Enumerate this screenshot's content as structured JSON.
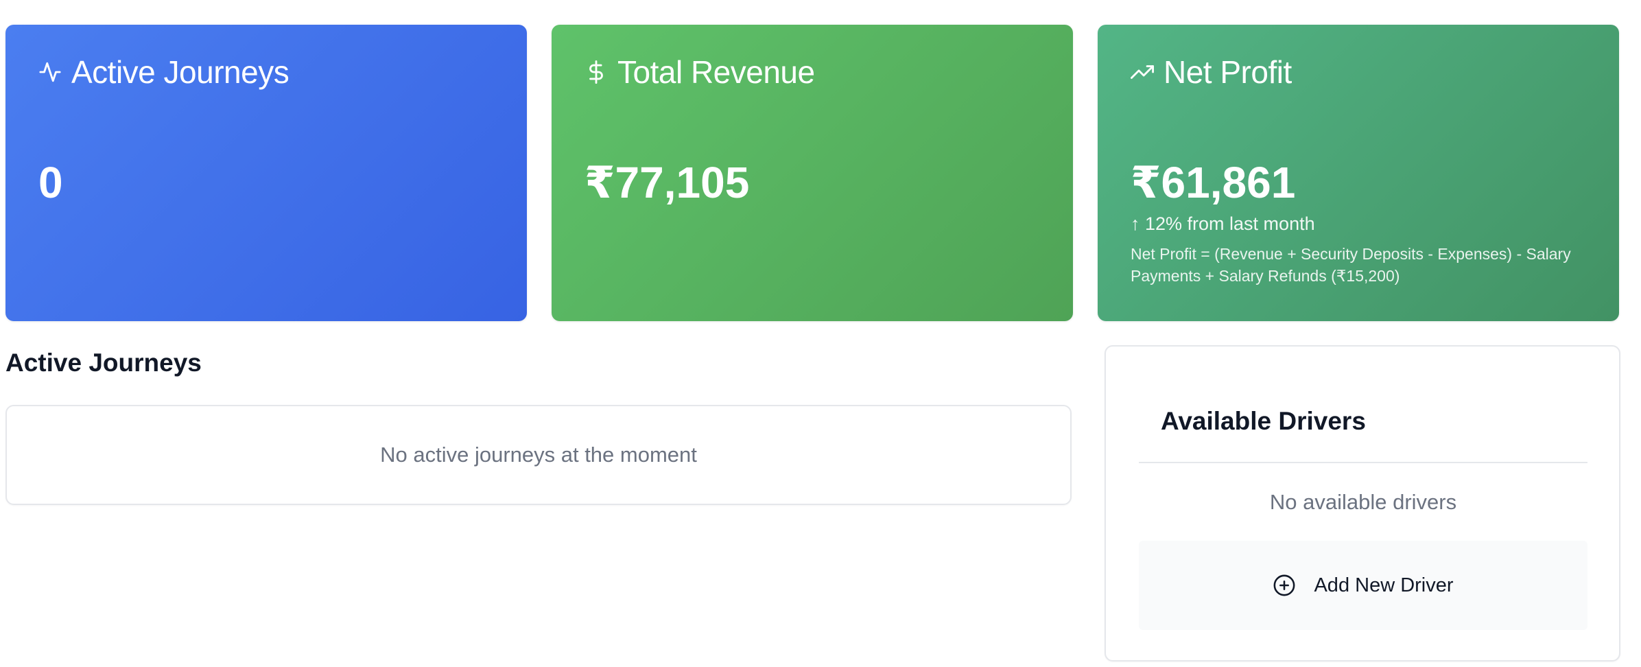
{
  "stats": {
    "active_journeys": {
      "icon": "activity-icon",
      "title": "Active Journeys",
      "value": "0",
      "color": "#4470EA"
    },
    "total_revenue": {
      "icon": "dollar-icon",
      "title": "Total Revenue",
      "value": "₹77,105",
      "color": "#57B260"
    },
    "net_profit": {
      "icon": "trending-up-icon",
      "title": "Net Profit",
      "value": "₹61,861",
      "trend": "↑ 12% from last month",
      "formula": "Net Profit = (Revenue + Security Deposits - Expenses) - Salary Payments + Salary Refunds (₹15,200)",
      "color": "#4AA475"
    }
  },
  "journeys": {
    "title": "Active Journeys",
    "empty_text": "No active journeys at the moment"
  },
  "drivers": {
    "title": "Available Drivers",
    "empty_text": "No available drivers",
    "add_button": {
      "icon": "plus-circle-icon",
      "label": "Add New Driver"
    }
  }
}
